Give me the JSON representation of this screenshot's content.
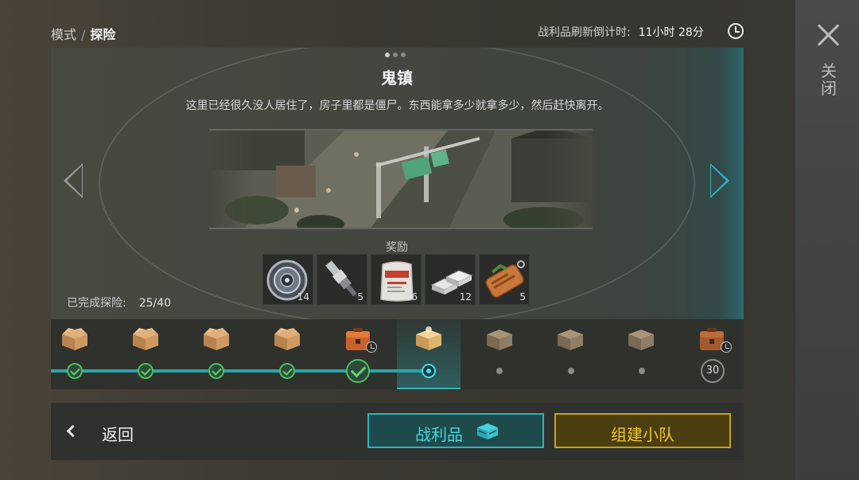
{
  "breadcrumb": {
    "mode": "模式",
    "separator": "/",
    "current": "探险"
  },
  "timer": {
    "label": "战利品刷新倒计时:",
    "value": "11小时 28分"
  },
  "close": {
    "label": "关闭"
  },
  "location": {
    "title": "鬼镇",
    "description": "这里已经很久没人居住了，房子里都是僵尸。东西能拿多少就拿多少，然后赶快离开。",
    "page_dots": 3,
    "active_page": 1
  },
  "rewards": {
    "label": "奖励",
    "items": [
      {
        "icon": "pulley-icon",
        "count": "14"
      },
      {
        "icon": "spark-plug-icon",
        "count": "5"
      },
      {
        "icon": "asbestos-bag-icon",
        "count": "16"
      },
      {
        "icon": "metal-bars-icon",
        "count": "12"
      },
      {
        "icon": "dog-tag-icon",
        "count": "5"
      }
    ]
  },
  "progress_summary": {
    "label": "已完成探险:",
    "value": "25/40"
  },
  "track": {
    "nodes": [
      {
        "state": "done",
        "box": "cardboard"
      },
      {
        "state": "done",
        "box": "cardboard"
      },
      {
        "state": "done",
        "box": "cardboard"
      },
      {
        "state": "done",
        "box": "cardboard"
      },
      {
        "state": "done-big",
        "box": "orange-crate",
        "timed": true
      },
      {
        "state": "current",
        "box": "glowing-crate"
      },
      {
        "state": "locked",
        "box": "closed-crate"
      },
      {
        "state": "locked",
        "box": "closed-crate"
      },
      {
        "state": "locked",
        "box": "closed-crate"
      },
      {
        "state": "milestone",
        "box": "orange-crate",
        "timed": true,
        "number": "30"
      }
    ]
  },
  "bottom": {
    "back_label": "返回",
    "loot_label": "战利品",
    "team_label": "组建小队"
  },
  "colors": {
    "accent_teal": "#2fb3b9",
    "accent_gold": "#c7a21d",
    "success_green": "#4ac25a"
  }
}
